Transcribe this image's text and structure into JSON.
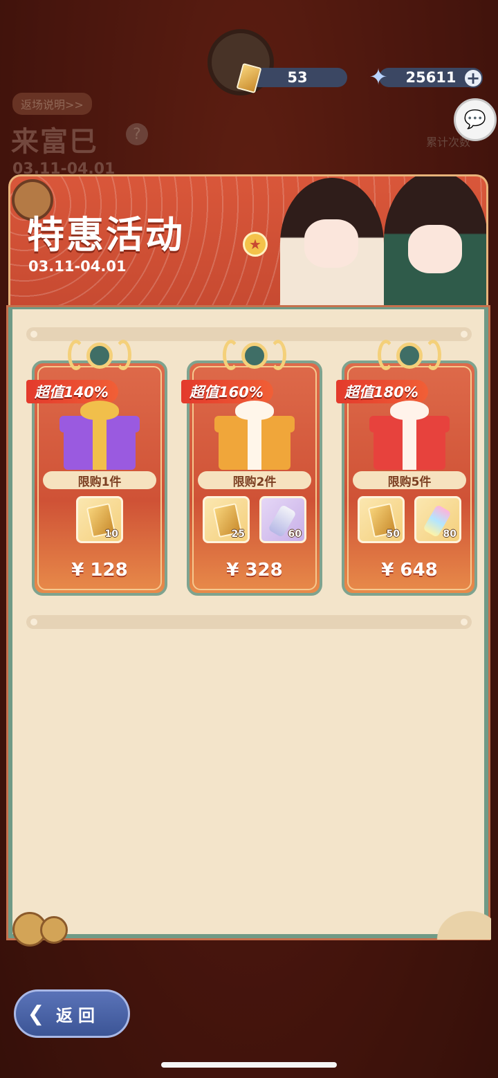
{
  "currency": {
    "tickets": "53",
    "stars": "25611",
    "add_label": "+",
    "colors": {
      "bar": "#3b4763"
    }
  },
  "background": {
    "rules_link": "返场说明>>",
    "event_title": "来富巳",
    "help_label": "?",
    "event_date": "03.11-04.01",
    "cumulative_label": "累计次数"
  },
  "promo": {
    "title": "特惠活动",
    "date": "03.11-04.01",
    "accent": "#d9573a",
    "panel_border": "#6f9a86"
  },
  "packs": [
    {
      "value_tag": "超值140%",
      "limit": "限购1件",
      "items": [
        {
          "icon": "ticket-icon",
          "count": "10"
        }
      ],
      "price": "¥ 128"
    },
    {
      "value_tag": "超值160%",
      "limit": "限购2件",
      "items": [
        {
          "icon": "ticket-icon",
          "count": "25"
        },
        {
          "icon": "bottle-icon",
          "count": "60"
        }
      ],
      "price": "¥ 328"
    },
    {
      "value_tag": "超值180%",
      "limit": "限购5件",
      "items": [
        {
          "icon": "ticket-icon",
          "count": "50"
        },
        {
          "icon": "rainbow-bottle-icon",
          "count": "80"
        }
      ],
      "price": "¥ 648"
    }
  ],
  "back_button": {
    "label": "返回",
    "icon": "back-arrow-icon"
  }
}
